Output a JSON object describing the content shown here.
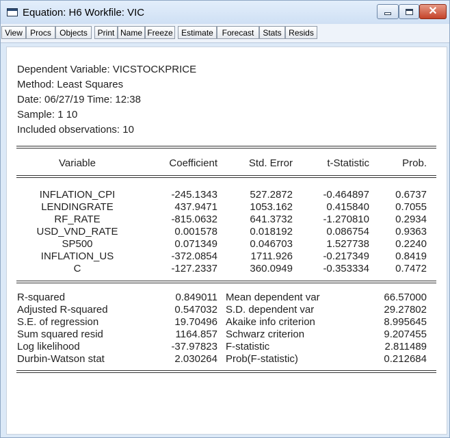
{
  "window": {
    "title": "Equation: H6   Workfile: VIC"
  },
  "toolbar": [
    {
      "label": "View"
    },
    {
      "label": "Procs"
    },
    {
      "label": "Objects"
    },
    {
      "label": "Print"
    },
    {
      "label": "Name"
    },
    {
      "label": "Freeze"
    },
    {
      "label": "Estimate"
    },
    {
      "label": "Forecast"
    },
    {
      "label": "Stats"
    },
    {
      "label": "Resids"
    }
  ],
  "header": {
    "dependent": "Dependent Variable: VICSTOCKPRICE",
    "method": "Method: Least Squares",
    "date": "Date: 06/27/19   Time: 12:38",
    "sample": "Sample: 1 10",
    "obs": "Included observations: 10"
  },
  "coef_table": {
    "columns": [
      "Variable",
      "Coefficient",
      "Std. Error",
      "t-Statistic",
      "Prob."
    ],
    "rows": [
      [
        "INFLATION_CPI",
        "-245.1343",
        "527.2872",
        "-0.464897",
        "0.6737"
      ],
      [
        "LENDINGRATE",
        "437.9471",
        "1053.162",
        "0.415840",
        "0.7055"
      ],
      [
        "RF_RATE",
        "-815.0632",
        "641.3732",
        "-1.270810",
        "0.2934"
      ],
      [
        "USD_VND_RATE",
        "0.001578",
        "0.018192",
        "0.086754",
        "0.9363"
      ],
      [
        "SP500",
        "0.071349",
        "0.046703",
        "1.527738",
        "0.2240"
      ],
      [
        "INFLATION_US",
        "-372.0854",
        "1711.926",
        "-0.217349",
        "0.8419"
      ],
      [
        "C",
        "-127.2337",
        "360.0949",
        "-0.353334",
        "0.7472"
      ]
    ]
  },
  "stats": {
    "left": [
      [
        "R-squared",
        "0.849011"
      ],
      [
        "Adjusted R-squared",
        "0.547032"
      ],
      [
        "S.E. of regression",
        "19.70496"
      ],
      [
        "Sum squared resid",
        "1164.857"
      ],
      [
        "Log likelihood",
        "-37.97823"
      ],
      [
        "Durbin-Watson stat",
        "2.030264"
      ]
    ],
    "right": [
      [
        "Mean dependent var",
        "66.57000"
      ],
      [
        "S.D. dependent var",
        "29.27802"
      ],
      [
        "Akaike info criterion",
        "8.995645"
      ],
      [
        "Schwarz criterion",
        "9.207455"
      ],
      [
        "F-statistic",
        "2.811489"
      ],
      [
        "Prob(F-statistic)",
        "0.212684"
      ]
    ]
  },
  "icons": {
    "window": "window-icon",
    "minimize": "minimize-icon",
    "maximize": "maximize-icon",
    "close": "close-icon"
  }
}
